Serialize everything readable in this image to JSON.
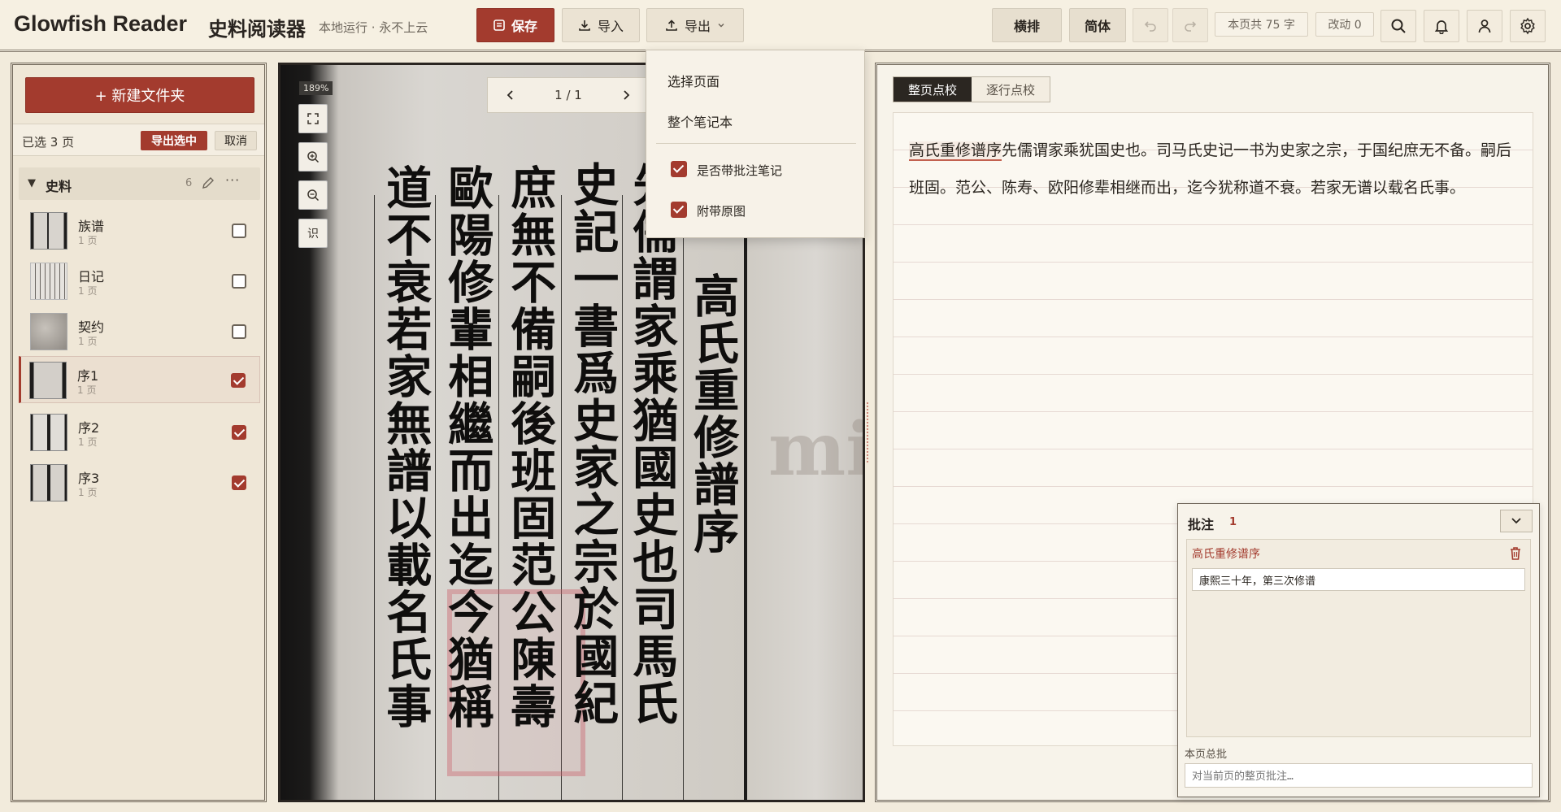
{
  "app": {
    "title": "Glowfish Reader",
    "title_zh": "史料阅读器",
    "subtitle": "本地运行 · 永不上云"
  },
  "toolbar": {
    "save": "保存",
    "import": "导入",
    "export": "导出",
    "horizontal": "横排",
    "simplified": "简体",
    "char_count": "本页共 75 字",
    "changes": "改动 0"
  },
  "export_menu": {
    "items": [
      "选择页面",
      "整个笔记本"
    ],
    "options": [
      {
        "label": "是否带批注笔记",
        "checked": true
      },
      {
        "label": "附带原图",
        "checked": true
      }
    ]
  },
  "sidebar": {
    "new_folder": "+ 新建文件夹",
    "selected": "已选 3 页",
    "export_selected": "导出选中",
    "cancel": "取消",
    "folder": {
      "name": "史料",
      "count": "6"
    },
    "items": [
      {
        "name": "族谱",
        "pages": "1 页",
        "checked": false
      },
      {
        "name": "日记",
        "pages": "1 页",
        "checked": false
      },
      {
        "name": "契约",
        "pages": "1 页",
        "checked": false
      },
      {
        "name": "序1",
        "pages": "1 页",
        "checked": true,
        "active": true
      },
      {
        "name": "序2",
        "pages": "1 页",
        "checked": true
      },
      {
        "name": "序3",
        "pages": "1 页",
        "checked": true
      }
    ]
  },
  "viewer": {
    "zoom": "189%",
    "page": "1 / 1",
    "ocr": "识",
    "watermark": "mily",
    "columns": [
      "高氏重修譜序",
      "先儒謂家乘猶國史也司馬氏",
      "史記一書爲史家之宗於國紀",
      "庶無不備嗣後班固范公陳壽",
      "歐陽修輩相繼而出迄今猶稱",
      "道不衰若家無譜以載名氏事"
    ]
  },
  "editor": {
    "tabs": [
      "整页点校",
      "逐行点校"
    ],
    "highlight": "高氏重修谱序",
    "text": "先儒谓家乘犹国史也。司马氏史记一书为史家之宗，于国纪庶无不备。嗣后班固。范公、陈寿、欧阳修辈相继而出，迄今犹称道不衰。若家无谱以载名氏事。"
  },
  "annotations": {
    "title": "批注",
    "count": "1",
    "note_title": "高氏重修谱序",
    "note_text": "康熙三十年，第三次修谱",
    "total_label": "本页总批",
    "total_placeholder": "对当前页的整页批注…"
  }
}
